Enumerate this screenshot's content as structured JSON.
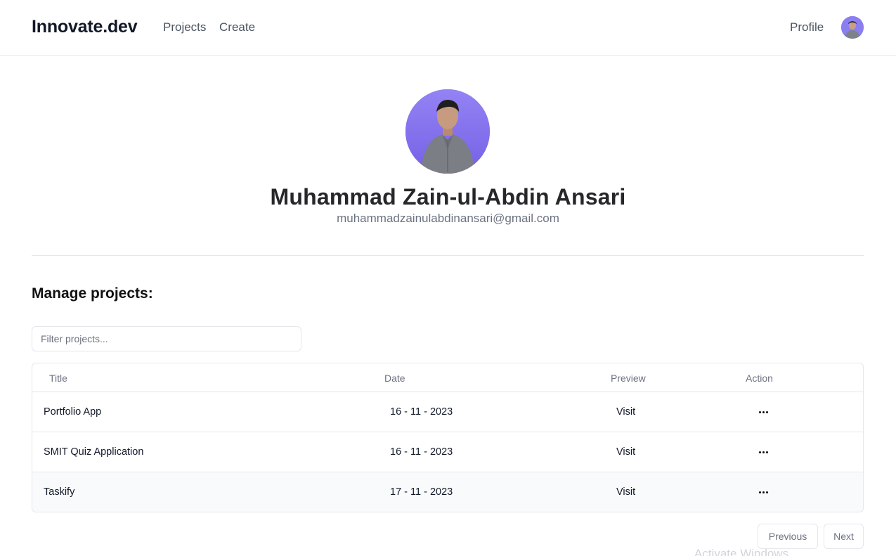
{
  "header": {
    "brand": "Innovate.dev",
    "nav": {
      "projects": "Projects",
      "create": "Create"
    },
    "profile_link": "Profile"
  },
  "profile": {
    "name": "Muhammad Zain-ul-Abdin Ansari",
    "email": "muhammadzainulabdinansari@gmail.com"
  },
  "manage": {
    "title": "Manage projects:",
    "filter_placeholder": "Filter projects..."
  },
  "table": {
    "headers": {
      "title": "Title",
      "date": "Date",
      "preview": "Preview",
      "action": "Action"
    },
    "rows": [
      {
        "title": "Portfolio App",
        "date": "16 - 11 - 2023",
        "preview": "Visit"
      },
      {
        "title": "SMIT Quiz Application",
        "date": "16 - 11 - 2023",
        "preview": "Visit"
      },
      {
        "title": "Taskify",
        "date": "17 - 11 - 2023",
        "preview": "Visit"
      }
    ]
  },
  "pagination": {
    "previous": "Previous",
    "next": "Next"
  },
  "watermark": "Activate Windows",
  "colors": {
    "avatar_bg": "#8b7ff0",
    "text": "#111827",
    "muted": "#6b7280",
    "border": "#e5e7eb"
  }
}
